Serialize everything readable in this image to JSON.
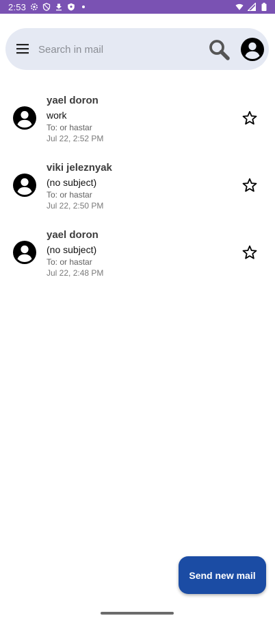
{
  "status_bar": {
    "time": "2:53",
    "background": "#7a52b3",
    "left_icons": [
      "settings-icon",
      "shield-icon",
      "download-icon",
      "security-icon",
      "dot-icon"
    ],
    "right_icons": [
      "wifi-icon",
      "cell-signal-icon",
      "battery-icon"
    ]
  },
  "search": {
    "placeholder": "Search in mail",
    "value": "",
    "background": "#e5e9f3"
  },
  "mails": [
    {
      "sender": "yael doron",
      "subject": "work",
      "to": "To: or hastar",
      "date": "Jul 22, 2:52 PM",
      "starred": false
    },
    {
      "sender": "viki jeleznyak",
      "subject": "(no subject)",
      "to": "To: or hastar",
      "date": "Jul 22, 2:50 PM",
      "starred": false
    },
    {
      "sender": "yael doron",
      "subject": "(no subject)",
      "to": "To: or hastar",
      "date": "Jul 22, 2:48 PM",
      "starred": false
    }
  ],
  "fab": {
    "label": "Send new mail",
    "color": "#1b4ca4"
  }
}
